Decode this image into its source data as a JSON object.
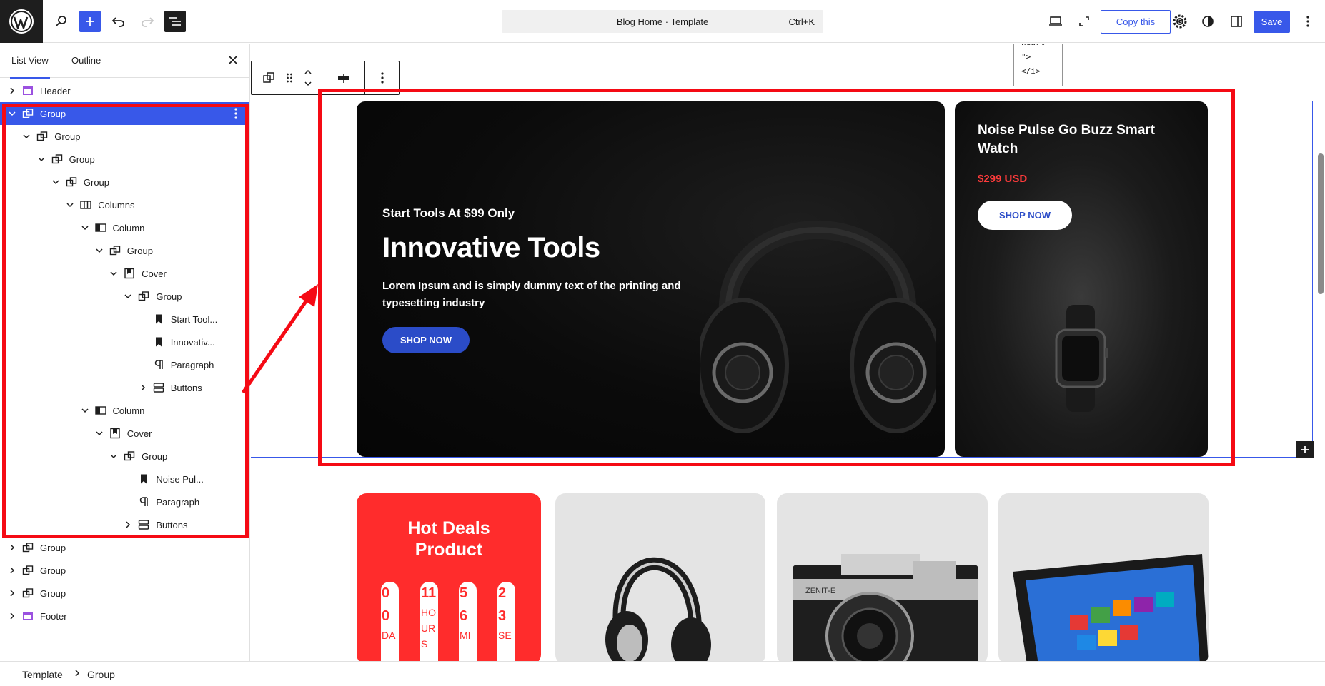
{
  "topbar": {
    "command_title": "Blog Home · Template",
    "command_shortcut": "Ctrl+K",
    "copy_label": "Copy this",
    "save_label": "Save",
    "accent": "#3858e9"
  },
  "sidebar": {
    "tabs": [
      "List View",
      "Outline"
    ],
    "tree": [
      {
        "label": "Header",
        "icon": "template-part-icon"
      },
      {
        "label": "Group",
        "icon": "group-icon",
        "selected": true
      },
      {
        "label": "Group",
        "icon": "group-icon"
      },
      {
        "label": "Group",
        "icon": "group-icon"
      },
      {
        "label": "Group",
        "icon": "group-icon"
      },
      {
        "label": "Columns",
        "icon": "columns-icon"
      },
      {
        "label": "Column",
        "icon": "column-icon"
      },
      {
        "label": "Group",
        "icon": "group-icon"
      },
      {
        "label": "Cover",
        "icon": "cover-icon"
      },
      {
        "label": "Group",
        "icon": "group-icon"
      },
      {
        "label": "Start Tool...",
        "icon": "heading-icon"
      },
      {
        "label": "Innovativ...",
        "icon": "heading-icon"
      },
      {
        "label": "Paragraph",
        "icon": "paragraph-icon"
      },
      {
        "label": "Buttons",
        "icon": "buttons-icon"
      },
      {
        "label": "Column",
        "icon": "column-icon"
      },
      {
        "label": "Cover",
        "icon": "cover-icon"
      },
      {
        "label": "Group",
        "icon": "group-icon"
      },
      {
        "label": "Noise Pul...",
        "icon": "heading-icon"
      },
      {
        "label": "Paragraph",
        "icon": "paragraph-icon"
      },
      {
        "label": "Buttons",
        "icon": "buttons-icon"
      },
      {
        "label": "Group",
        "icon": "group-icon"
      },
      {
        "label": "Group",
        "icon": "group-icon"
      },
      {
        "label": "Group",
        "icon": "group-icon"
      },
      {
        "label": "Footer",
        "icon": "template-part-icon"
      }
    ]
  },
  "canvas": {
    "code_snippet": "heart\n\">\n</i>",
    "hero": {
      "eyebrow": "Start Tools At $99 Only",
      "title": "Innovative Tools",
      "text": "Lorem Ipsum and is simply dummy text of the printing and typesetting industry",
      "button": "SHOP NOW"
    },
    "watch": {
      "title": "Noise Pulse Go Buzz Smart Watch",
      "price": "$299 USD",
      "button": "SHOP NOW"
    },
    "deals": {
      "title": "Hot Deals Product",
      "countdown": [
        {
          "num": "0",
          "num2": "0",
          "unit": "DA"
        },
        {
          "num": "11",
          "unit": "HO",
          "unit2": "UR",
          "unit3": "S"
        },
        {
          "num": "5",
          "num2": "6",
          "unit": "MI"
        },
        {
          "num": "2",
          "num2": "3",
          "unit": "SE"
        }
      ]
    }
  },
  "breadcrumb": {
    "root": "Template",
    "current": "Group"
  },
  "colors": {
    "annotation_red": "#f50a14",
    "deals_red": "#ff2c2c",
    "price_red": "#ff3b3b",
    "hero_button_blue": "#2b4cc8"
  }
}
